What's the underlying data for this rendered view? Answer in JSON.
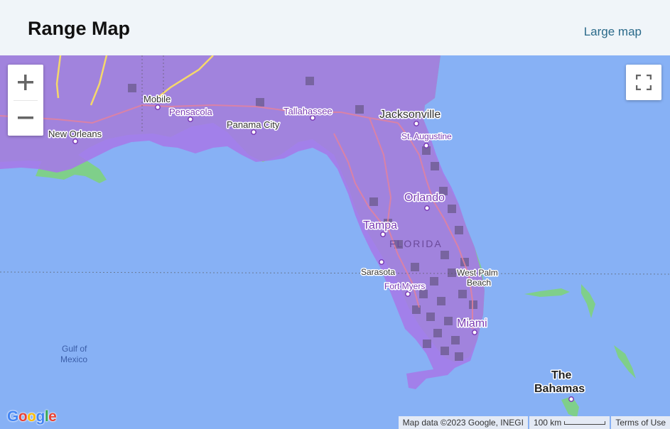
{
  "header": {
    "title": "Range Map",
    "large_map_link": "Large map"
  },
  "controls": {
    "zoom_in": "+",
    "zoom_out": "−"
  },
  "map": {
    "labels": {
      "new_orleans": "New Orleans",
      "mobile": "Mobile",
      "pensacola": "Pensacola",
      "panama_city": "Panama City",
      "tallahassee": "Tallahassee",
      "jacksonville": "Jacksonville",
      "st_augustine": "St. Augustine",
      "orlando": "Orlando",
      "tampa": "Tampa",
      "florida": "FLORIDA",
      "sarasota": "Sarasota",
      "west_palm": "West Palm",
      "beach": "Beach",
      "fort_myers": "Fort Myers",
      "miami": "Miami",
      "gulf_of": "Gulf of",
      "mexico": "Mexico",
      "the": "The",
      "bahamas": "Bahamas"
    },
    "colors": {
      "water": "#87b1f5",
      "land": "#7fcf8a",
      "range": "#a679e8",
      "range_dense": "#6b5a8c"
    }
  },
  "footer": {
    "map_data": "Map data ©2023 Google, INEGI",
    "scale": "100 km",
    "terms": "Terms of Use"
  },
  "logo": {
    "text": "Google"
  }
}
